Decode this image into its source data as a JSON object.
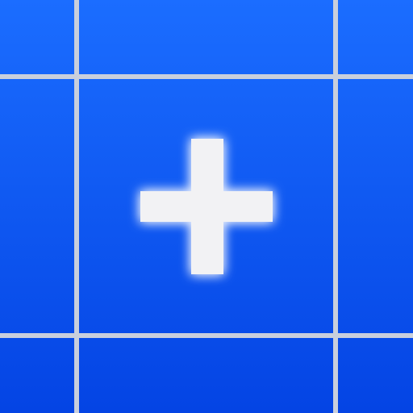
{
  "icon": {
    "name": "plus-grid-app-icon",
    "glyph": "plus-icon",
    "colors": {
      "background_top": "#1b6dff",
      "background_bottom": "#0444e4",
      "grid_line": "#c9cfdc",
      "plus_fill": "#f2f2f4",
      "plus_glow": "#ffffff"
    }
  }
}
